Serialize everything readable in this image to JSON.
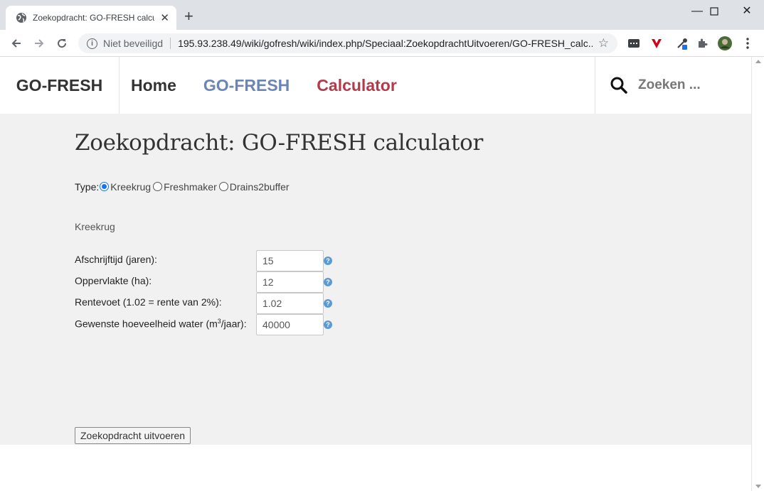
{
  "browser": {
    "tab_title": "Zoekopdracht: GO-FRESH calculator",
    "security_label": "Niet beveiligd",
    "url": "195.93.238.49/wiki/gofresh/wiki/index.php/Speciaal:ZoekopdrachtUitvoeren/GO-FRESH_calc...",
    "icons": [
      "globe-icon",
      "close-icon",
      "new-tab-icon",
      "back-icon",
      "forward-icon",
      "reload-icon",
      "info-icon",
      "bookmark-star-icon",
      "extension-icon",
      "puzzle-icon",
      "profile-avatar",
      "menu-dots-icon"
    ]
  },
  "site": {
    "brand": "GO-FRESH",
    "nav": {
      "home": "Home",
      "gofresh": "GO-FRESH",
      "calculator": "Calculator"
    },
    "search_placeholder": "Zoeken ..."
  },
  "page": {
    "title": "Zoekopdracht: GO-FRESH calculator",
    "type_label": "Type:",
    "type_options": [
      "Kreekrug",
      "Freshmaker",
      "Drains2buffer"
    ],
    "type_selected": "Kreekrug",
    "section_title": "Kreekrug",
    "fields": [
      {
        "label": "Afschrijftijd (jaren):",
        "value": "15"
      },
      {
        "label": "Oppervlakte (ha):",
        "value": "12"
      },
      {
        "label": "Rentevoet (1.02 = rente van 2%):",
        "value": "1.02"
      },
      {
        "label_pre": "Gewenste hoeveelheid water (m",
        "label_sup": "3",
        "label_post": "/jaar):",
        "value": "40000"
      }
    ],
    "submit_label": "Zoekopdracht uitvoeren"
  },
  "colors": {
    "nav_gofresh": "#6a85b6",
    "nav_calculator": "#b33a4a",
    "content_bg": "#f1f1f1",
    "radio_selected": "#1a73e8",
    "help_icon": "#5b9bd5"
  }
}
